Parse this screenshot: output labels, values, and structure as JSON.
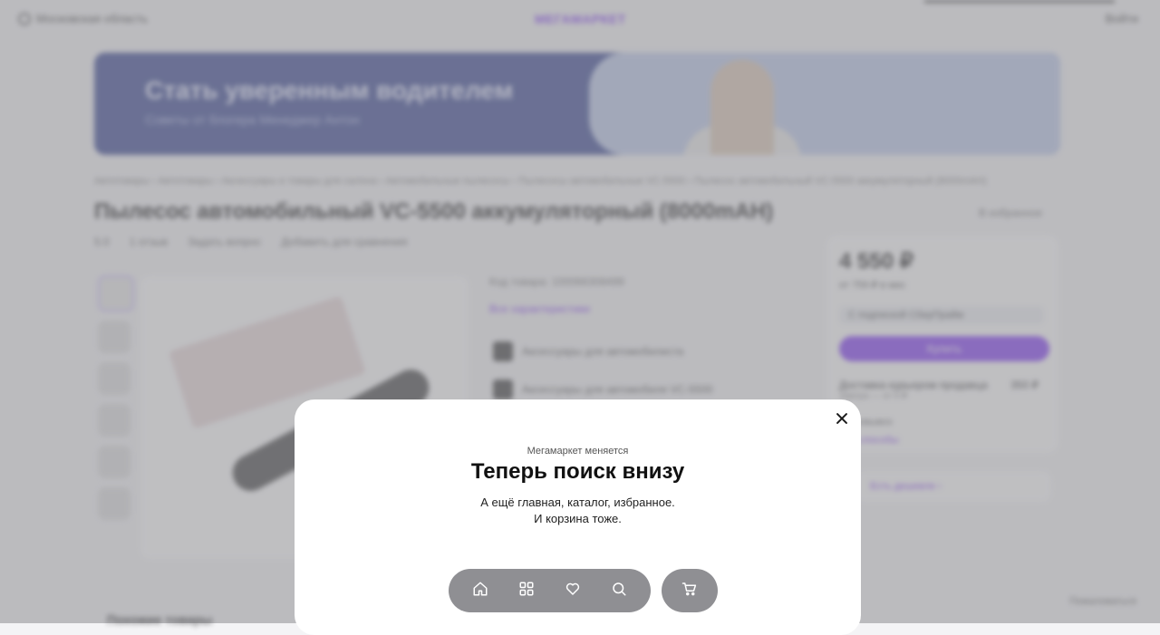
{
  "background_page": {
    "region": "Московская область",
    "logo": "МЕГАМАРКЕТ",
    "login": "Войти",
    "banner": {
      "title": "Стать уверенным водителем",
      "subtitle": "Советы от блогера Менеджер Антон"
    },
    "breadcrumbs": "Автотовары  ›  Автотовары  ›  Аксессуары и товары для салона  ›  Автомобильные пылесосы  ›  Пылесосы автомобильные VC-5500  ›  Пылесос автомобильный VC-5500 аккумуляторный (8000mAH)",
    "product_title": "Пылесос автомобильный VC-5500 аккумуляторный (8000mAH)",
    "favorites": "В избранное",
    "rating": "5.0",
    "reviews": "1 отзыв",
    "ask": "Задать вопрос",
    "compare": "Добавить для сравнения",
    "article": "Код товара: 100066308499",
    "characteristics": "Все характеристики",
    "accessory1": "Аксессуары для автомобилиста",
    "accessory2": "Аксессуары для автомобиля VC-5500",
    "price": "4 550 ₽",
    "price_sub": "от 759 ₽ в мес",
    "card_offer": "С подпиской СберПрайм",
    "buy_button": "Купить",
    "delivery": "Доставка курьером продавца",
    "delivery_sub": "Завтра — от 0 ₽",
    "delivery_price": "350 ₽",
    "pickup": "Самовывоз",
    "pickup_link": "Все способы",
    "cheaper": "Есть дешевле ›",
    "similar": "Похожие товары",
    "complain": "Пожаловаться"
  },
  "modal": {
    "kicker": "Мегамаркет меняется",
    "title": "Теперь поиск внизу",
    "line1": "А ещё главная, каталог, избранное.",
    "line2": "И корзина тоже.",
    "nav_icons": [
      "home-icon",
      "catalog-icon",
      "heart-icon",
      "search-icon"
    ],
    "cart_icon": "cart-icon"
  },
  "colors": {
    "brand": "#7b2ff7",
    "navbar": "#8f8f93",
    "overlay": "rgba(40,40,45,0.28)"
  }
}
